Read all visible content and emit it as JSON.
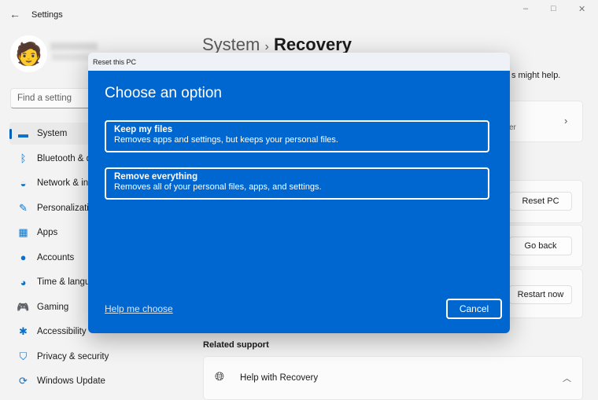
{
  "window": {
    "title": "Settings",
    "back_icon": "arrow-left-icon",
    "minimize": "–",
    "maximize": "□",
    "close": "✕"
  },
  "search": {
    "placeholder": "Find a setting"
  },
  "sidebar": {
    "items": [
      {
        "label": "System",
        "icon": "monitor-icon",
        "glyph": "▬"
      },
      {
        "label": "Bluetooth & devices",
        "icon": "bluetooth-icon",
        "glyph": "ᛒ"
      },
      {
        "label": "Network & internet",
        "icon": "wifi-icon",
        "glyph": "◒"
      },
      {
        "label": "Personalization",
        "icon": "brush-icon",
        "glyph": "✎"
      },
      {
        "label": "Apps",
        "icon": "apps-icon",
        "glyph": "▦"
      },
      {
        "label": "Accounts",
        "icon": "person-icon",
        "glyph": "●"
      },
      {
        "label": "Time & language",
        "icon": "globe-clock-icon",
        "glyph": "◕"
      },
      {
        "label": "Gaming",
        "icon": "gamepad-icon",
        "glyph": "🎮"
      },
      {
        "label": "Accessibility",
        "icon": "accessibility-icon",
        "glyph": "✱"
      },
      {
        "label": "Privacy & security",
        "icon": "shield-icon",
        "glyph": "⛉"
      },
      {
        "label": "Windows Update",
        "icon": "update-icon",
        "glyph": "⟳"
      }
    ]
  },
  "header": {
    "crumb": "System",
    "sep": "›",
    "title": "Recovery",
    "subtitle": "s might help."
  },
  "cards": {
    "fix_tail": "er",
    "reset_button": "Reset PC",
    "goback_button": "Go back",
    "restart_button": "Restart now"
  },
  "related": {
    "heading": "Related support",
    "help_item": "Help with Recovery"
  },
  "dialog": {
    "title": "Reset this PC",
    "heading": "Choose an option",
    "options": [
      {
        "title": "Keep my files",
        "desc": "Removes apps and settings, but keeps your personal files."
      },
      {
        "title": "Remove everything",
        "desc": "Removes all of your personal files, apps, and settings."
      }
    ],
    "help_link": "Help me choose",
    "cancel": "Cancel"
  },
  "colors": {
    "accent": "#0067d0",
    "selection_bar": "#005fb8"
  }
}
